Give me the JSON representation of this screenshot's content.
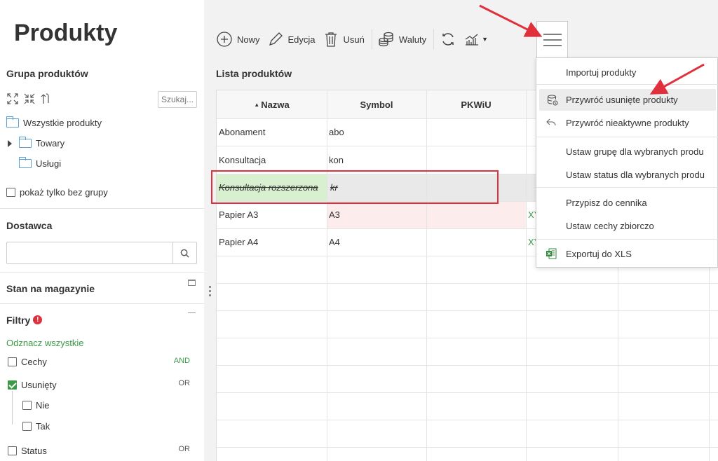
{
  "page_title": "Produkty",
  "product_group": {
    "title": "Grupa produktów",
    "search_placeholder": "Szukaj...",
    "tree": [
      {
        "label": "Wszystkie produkty"
      },
      {
        "label": "Towary"
      },
      {
        "label": "Usługi"
      }
    ],
    "no_group_label": "pokaż tylko bez grupy"
  },
  "supplier": {
    "title": "Dostawca",
    "value": ""
  },
  "stock": {
    "title": "Stan na magazynie"
  },
  "filters": {
    "title": "Filtry",
    "alert": "!",
    "select_all": "Odznacz wszystkie",
    "items": [
      {
        "label": "Cechy",
        "op": "AND",
        "checked": false
      },
      {
        "label": "Usunięty",
        "op": "OR",
        "checked": true
      },
      {
        "label": "Nie",
        "checked": false
      },
      {
        "label": "Tak",
        "checked": false
      },
      {
        "label": "Status",
        "op": "OR",
        "checked": false
      }
    ]
  },
  "toolbar": {
    "new_label": "Nowy",
    "edit_label": "Edycja",
    "delete_label": "Usuń",
    "currencies_label": "Waluty"
  },
  "list": {
    "title": "Lista produktów",
    "columns": [
      "Nazwa",
      "Symbol",
      "PKWiU"
    ],
    "sort_indicator": "▲",
    "rows": [
      {
        "name": "Abonament",
        "symbol": "abo",
        "pkwiu": "",
        "extra": ""
      },
      {
        "name": "Konsultacja",
        "symbol": "kon",
        "pkwiu": "",
        "extra": ""
      },
      {
        "name": "Konsultacja rozszerzona",
        "symbol": "kr",
        "pkwiu": "",
        "extra": ""
      },
      {
        "name": "Papier A3",
        "symbol": "A3",
        "pkwiu": "",
        "extra": "XY"
      },
      {
        "name": "Papier A4",
        "symbol": "A4",
        "pkwiu": "",
        "extra": "XY"
      }
    ]
  },
  "menu": {
    "items": [
      {
        "label": "Importuj produkty"
      },
      {
        "label": "Przywróć usunięte produkty"
      },
      {
        "label": "Przywróć nieaktywne produkty"
      },
      {
        "label": "Ustaw grupę dla wybranych produ"
      },
      {
        "label": "Ustaw status dla wybranych produ"
      },
      {
        "label": "Przypisz do cennika"
      },
      {
        "label": "Ustaw cechy zbiorczo"
      },
      {
        "label": "Exportuj do XLS"
      }
    ]
  },
  "colors": {
    "accent_green": "#3a9a47",
    "annotation_red": "#e0303c",
    "deleted_row_red": "#fdecec",
    "folder_blue": "#5a9fd4"
  }
}
